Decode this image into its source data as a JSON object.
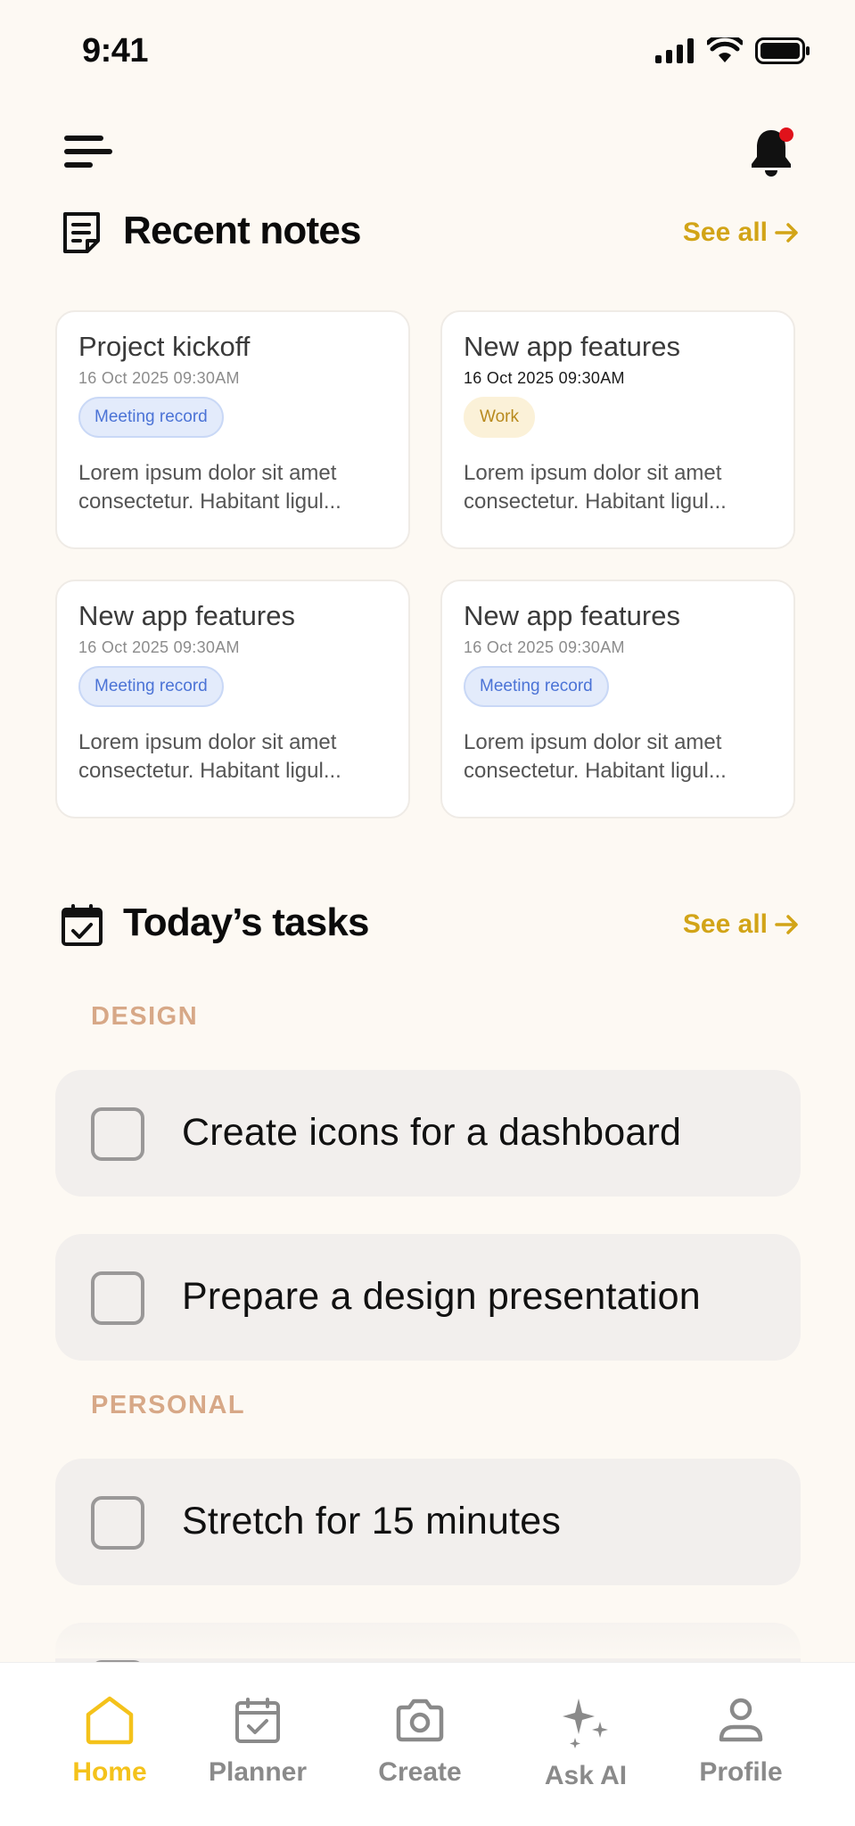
{
  "status_bar": {
    "time": "9:41"
  },
  "recent_notes": {
    "title": "Recent notes",
    "see_all": "See all",
    "notes": [
      {
        "title": "Project kickoff",
        "date": "16 Oct 2025 09:30AM",
        "tag": "Meeting record",
        "body": "Lorem ipsum dolor sit amet consectetur. Habitant ligul..."
      },
      {
        "title": "New app features",
        "date": "16 Oct 2025 09:30AM",
        "tag": "Work",
        "body": "Lorem ipsum dolor sit amet consectetur. Habitant ligul..."
      },
      {
        "title": "New app features",
        "date": "16 Oct 2025 09:30AM",
        "tag": "Meeting record",
        "body": "Lorem ipsum dolor sit amet consectetur. Habitant ligul..."
      },
      {
        "title": "New app features",
        "date": "16 Oct 2025 09:30AM",
        "tag": "Meeting record",
        "body": "Lorem ipsum dolor sit amet consectetur. Habitant ligul..."
      }
    ]
  },
  "todays_tasks": {
    "title": "Today’s tasks",
    "see_all": "See all",
    "categories": [
      {
        "name": "DESIGN",
        "tasks": [
          {
            "label": "Create icons for a dashboard",
            "done": false
          },
          {
            "label": "Prepare a design presentation",
            "done": false
          }
        ]
      },
      {
        "name": "PERSONAL",
        "tasks": [
          {
            "label": "Stretch for 15 minutes",
            "done": false
          }
        ]
      }
    ]
  },
  "tab_bar": {
    "active": "Home",
    "tabs": [
      {
        "label": "Home",
        "icon": "home-icon"
      },
      {
        "label": "Planner",
        "icon": "calendar-check-icon"
      },
      {
        "label": "Create",
        "icon": "camera-icon"
      },
      {
        "label": "Ask AI",
        "icon": "sparkles-icon"
      },
      {
        "label": "Profile",
        "icon": "user-icon"
      }
    ]
  },
  "colors": {
    "background": "#fdf9f3",
    "accent": "#f4c21b",
    "see_all": "#d2a417",
    "category": "#d7a887",
    "notification_dot": "#e0121b"
  }
}
